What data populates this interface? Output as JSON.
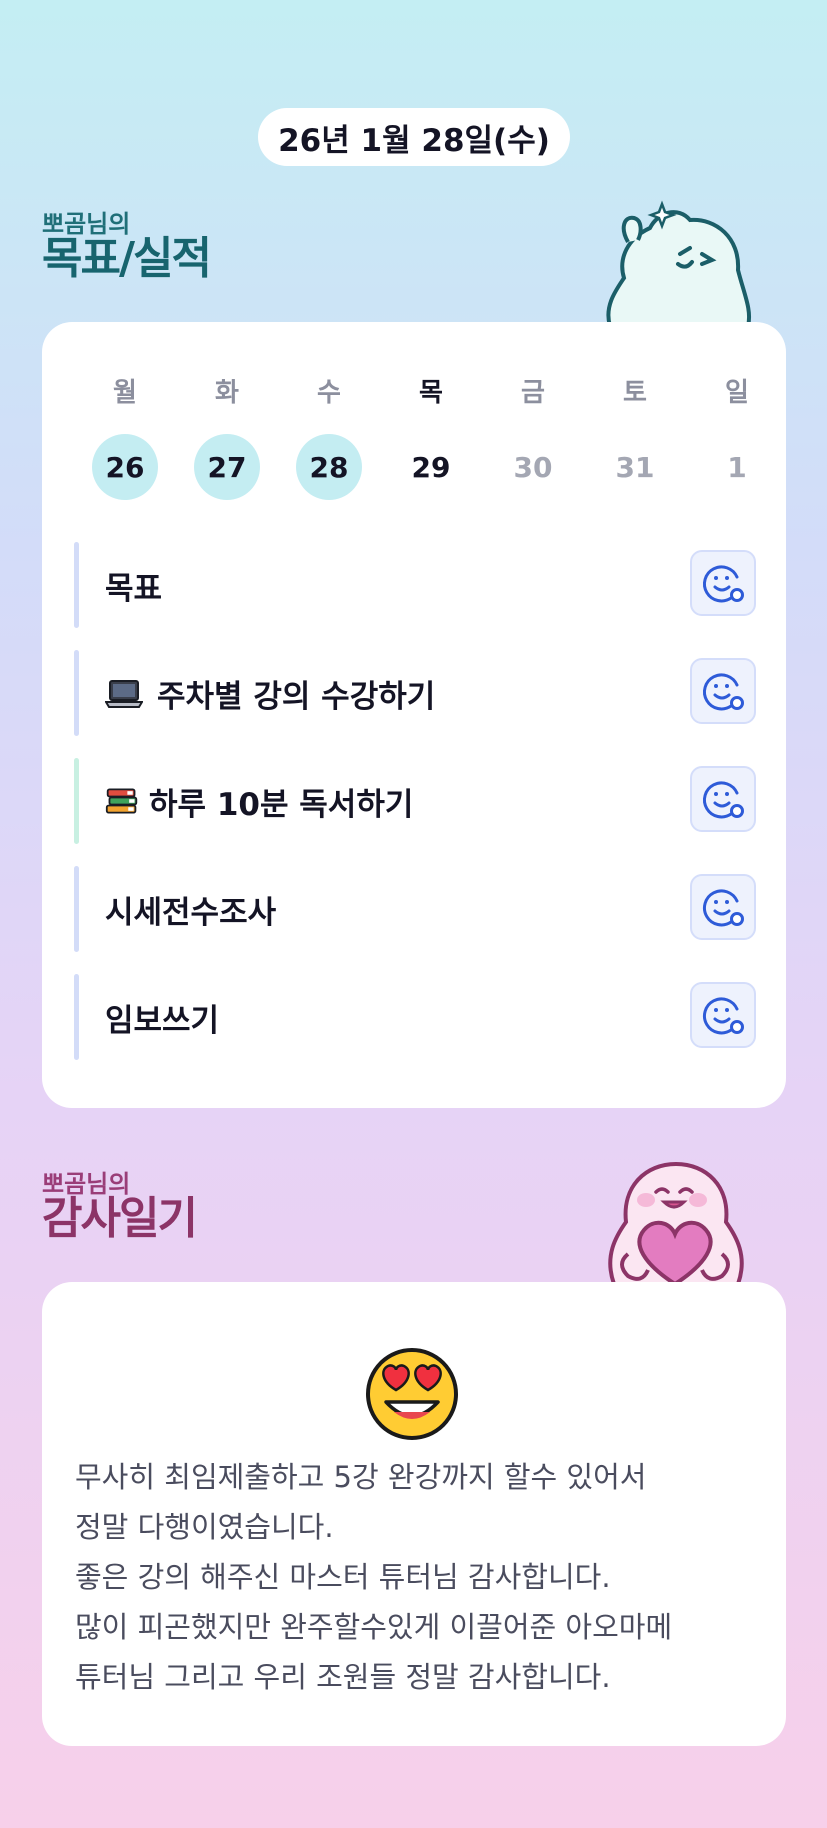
{
  "date_label": "26년 1월 28일(수)",
  "goals_section": {
    "owner": "뽀곰님의",
    "title": "목표/실적"
  },
  "week": {
    "weekdays": [
      "월",
      "화",
      "수",
      "목",
      "금",
      "토",
      "일"
    ],
    "days": [
      "26",
      "27",
      "28",
      "29",
      "30",
      "31",
      "1"
    ],
    "completed_days": [
      "26",
      "27",
      "28"
    ],
    "today": "29"
  },
  "goals": [
    {
      "label": "목표",
      "emoji": "",
      "bar_color": "#d3dcf8"
    },
    {
      "label": "주차별 강의 수강하기",
      "emoji": "laptop-icon",
      "bar_color": "#d3dcf8"
    },
    {
      "label": "하루 10분 독서하기",
      "emoji": "books-icon",
      "bar_color": "#c8f0e2"
    },
    {
      "label": "시세전수조사",
      "emoji": "",
      "bar_color": "#d3dcf8"
    },
    {
      "label": "임보쓰기",
      "emoji": "",
      "bar_color": "#d3dcf8"
    }
  ],
  "thanks_section": {
    "owner": "뽀곰님의",
    "title": "감사일기"
  },
  "thanks": {
    "emoji": "heart-eyes-face-icon",
    "text": "무사히 최임제출하고 5강 완강까지 할수 있어서\n정말 다행이였습니다.\n좋은 강의 해주신 마스터 튜터님 감사합니다.\n많이 피곤했지만 완주할수있게 이끌어준 아오마메\n튜터님 그리고 우리 조원들 정말 감사합니다."
  },
  "colors": {
    "goal_title": "#17646e",
    "thanks_title": "#8c3467",
    "completed_day": "#c4edf2",
    "reaction_button": "#2e5bd8"
  }
}
